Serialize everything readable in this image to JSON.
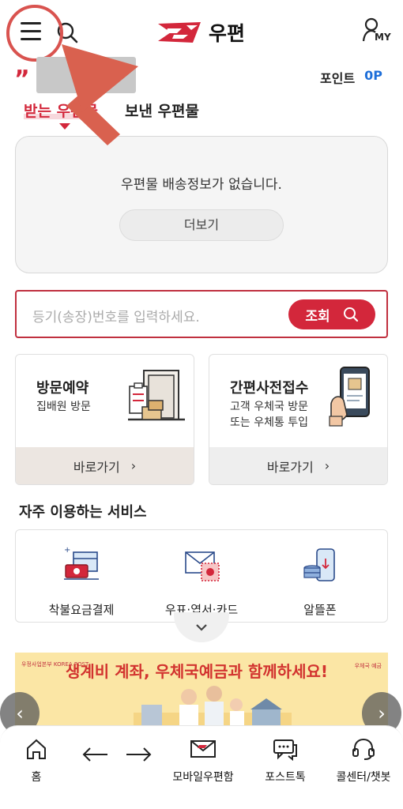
{
  "header": {
    "logo_text": "우편",
    "my_label": "MY"
  },
  "points": {
    "label": "포인트",
    "value": "0P"
  },
  "quote_mark": "”",
  "tabs": [
    {
      "label": "받는 우편물"
    },
    {
      "label": "보낸 우편물"
    }
  ],
  "delivery": {
    "empty_text": "우편물 배송정보가 없습니다.",
    "more_label": "더보기"
  },
  "tracking": {
    "placeholder": "등기(송장)번호를 입력하세요.",
    "button_label": "조회"
  },
  "cards": [
    {
      "title": "방문예약",
      "subtitle": "집배원 방문",
      "go_label": "바로가기"
    },
    {
      "title": "간편사전접수",
      "subtitle": "고객 우체국 방문\n또는 우체통 투입",
      "go_label": "바로가기"
    }
  ],
  "services": {
    "title": "자주 이용하는 서비스",
    "items": [
      {
        "label": "착불요금결제",
        "icon": "cod-payment-icon"
      },
      {
        "label": "우표·엽서·카드",
        "icon": "stamp-postcard-icon"
      },
      {
        "label": "알뜰폰",
        "icon": "budget-phone-icon"
      }
    ]
  },
  "banner": {
    "text": "생계비 계좌, 우체국예금과 함께하세요!",
    "brand_left": "우정사업본부 KOREA POST",
    "brand_right": "우체국 예금"
  },
  "bottom_nav": [
    {
      "label": "홈",
      "icon": "home-icon"
    },
    {
      "label": "",
      "icon": "back-arrow-icon"
    },
    {
      "label": "",
      "icon": "forward-arrow-icon"
    },
    {
      "label": "모바일우편함",
      "icon": "mailbox-icon"
    },
    {
      "label": "포스트톡",
      "icon": "chat-icon"
    },
    {
      "label": "콜센터/챗봇",
      "icon": "headset-icon"
    }
  ],
  "colors": {
    "brand_red": "#d3273b",
    "point_blue": "#1e6fd9",
    "annotation_red": "#d9534f"
  }
}
